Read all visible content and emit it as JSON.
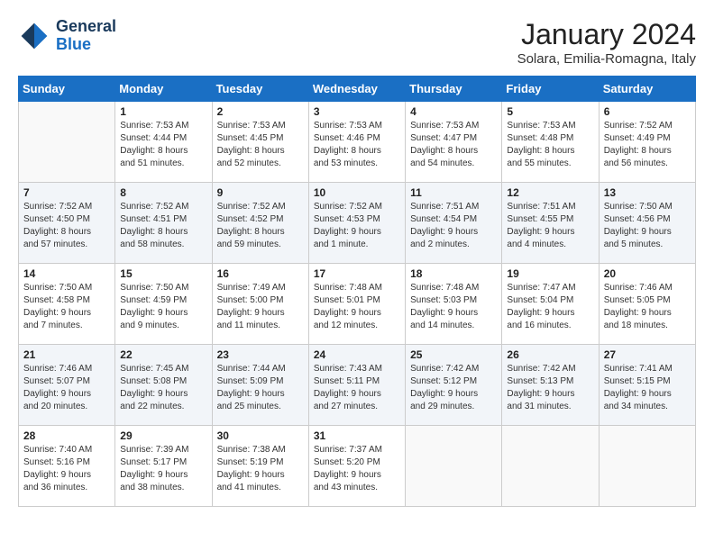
{
  "logo": {
    "line1": "General",
    "line2": "Blue"
  },
  "title": "January 2024",
  "location": "Solara, Emilia-Romagna, Italy",
  "days_of_week": [
    "Sunday",
    "Monday",
    "Tuesday",
    "Wednesday",
    "Thursday",
    "Friday",
    "Saturday"
  ],
  "weeks": [
    [
      {
        "day": "",
        "info": ""
      },
      {
        "day": "1",
        "info": "Sunrise: 7:53 AM\nSunset: 4:44 PM\nDaylight: 8 hours\nand 51 minutes."
      },
      {
        "day": "2",
        "info": "Sunrise: 7:53 AM\nSunset: 4:45 PM\nDaylight: 8 hours\nand 52 minutes."
      },
      {
        "day": "3",
        "info": "Sunrise: 7:53 AM\nSunset: 4:46 PM\nDaylight: 8 hours\nand 53 minutes."
      },
      {
        "day": "4",
        "info": "Sunrise: 7:53 AM\nSunset: 4:47 PM\nDaylight: 8 hours\nand 54 minutes."
      },
      {
        "day": "5",
        "info": "Sunrise: 7:53 AM\nSunset: 4:48 PM\nDaylight: 8 hours\nand 55 minutes."
      },
      {
        "day": "6",
        "info": "Sunrise: 7:52 AM\nSunset: 4:49 PM\nDaylight: 8 hours\nand 56 minutes."
      }
    ],
    [
      {
        "day": "7",
        "info": "Sunrise: 7:52 AM\nSunset: 4:50 PM\nDaylight: 8 hours\nand 57 minutes."
      },
      {
        "day": "8",
        "info": "Sunrise: 7:52 AM\nSunset: 4:51 PM\nDaylight: 8 hours\nand 58 minutes."
      },
      {
        "day": "9",
        "info": "Sunrise: 7:52 AM\nSunset: 4:52 PM\nDaylight: 8 hours\nand 59 minutes."
      },
      {
        "day": "10",
        "info": "Sunrise: 7:52 AM\nSunset: 4:53 PM\nDaylight: 9 hours\nand 1 minute."
      },
      {
        "day": "11",
        "info": "Sunrise: 7:51 AM\nSunset: 4:54 PM\nDaylight: 9 hours\nand 2 minutes."
      },
      {
        "day": "12",
        "info": "Sunrise: 7:51 AM\nSunset: 4:55 PM\nDaylight: 9 hours\nand 4 minutes."
      },
      {
        "day": "13",
        "info": "Sunrise: 7:50 AM\nSunset: 4:56 PM\nDaylight: 9 hours\nand 5 minutes."
      }
    ],
    [
      {
        "day": "14",
        "info": "Sunrise: 7:50 AM\nSunset: 4:58 PM\nDaylight: 9 hours\nand 7 minutes."
      },
      {
        "day": "15",
        "info": "Sunrise: 7:50 AM\nSunset: 4:59 PM\nDaylight: 9 hours\nand 9 minutes."
      },
      {
        "day": "16",
        "info": "Sunrise: 7:49 AM\nSunset: 5:00 PM\nDaylight: 9 hours\nand 11 minutes."
      },
      {
        "day": "17",
        "info": "Sunrise: 7:48 AM\nSunset: 5:01 PM\nDaylight: 9 hours\nand 12 minutes."
      },
      {
        "day": "18",
        "info": "Sunrise: 7:48 AM\nSunset: 5:03 PM\nDaylight: 9 hours\nand 14 minutes."
      },
      {
        "day": "19",
        "info": "Sunrise: 7:47 AM\nSunset: 5:04 PM\nDaylight: 9 hours\nand 16 minutes."
      },
      {
        "day": "20",
        "info": "Sunrise: 7:46 AM\nSunset: 5:05 PM\nDaylight: 9 hours\nand 18 minutes."
      }
    ],
    [
      {
        "day": "21",
        "info": "Sunrise: 7:46 AM\nSunset: 5:07 PM\nDaylight: 9 hours\nand 20 minutes."
      },
      {
        "day": "22",
        "info": "Sunrise: 7:45 AM\nSunset: 5:08 PM\nDaylight: 9 hours\nand 22 minutes."
      },
      {
        "day": "23",
        "info": "Sunrise: 7:44 AM\nSunset: 5:09 PM\nDaylight: 9 hours\nand 25 minutes."
      },
      {
        "day": "24",
        "info": "Sunrise: 7:43 AM\nSunset: 5:11 PM\nDaylight: 9 hours\nand 27 minutes."
      },
      {
        "day": "25",
        "info": "Sunrise: 7:42 AM\nSunset: 5:12 PM\nDaylight: 9 hours\nand 29 minutes."
      },
      {
        "day": "26",
        "info": "Sunrise: 7:42 AM\nSunset: 5:13 PM\nDaylight: 9 hours\nand 31 minutes."
      },
      {
        "day": "27",
        "info": "Sunrise: 7:41 AM\nSunset: 5:15 PM\nDaylight: 9 hours\nand 34 minutes."
      }
    ],
    [
      {
        "day": "28",
        "info": "Sunrise: 7:40 AM\nSunset: 5:16 PM\nDaylight: 9 hours\nand 36 minutes."
      },
      {
        "day": "29",
        "info": "Sunrise: 7:39 AM\nSunset: 5:17 PM\nDaylight: 9 hours\nand 38 minutes."
      },
      {
        "day": "30",
        "info": "Sunrise: 7:38 AM\nSunset: 5:19 PM\nDaylight: 9 hours\nand 41 minutes."
      },
      {
        "day": "31",
        "info": "Sunrise: 7:37 AM\nSunset: 5:20 PM\nDaylight: 9 hours\nand 43 minutes."
      },
      {
        "day": "",
        "info": ""
      },
      {
        "day": "",
        "info": ""
      },
      {
        "day": "",
        "info": ""
      }
    ]
  ]
}
